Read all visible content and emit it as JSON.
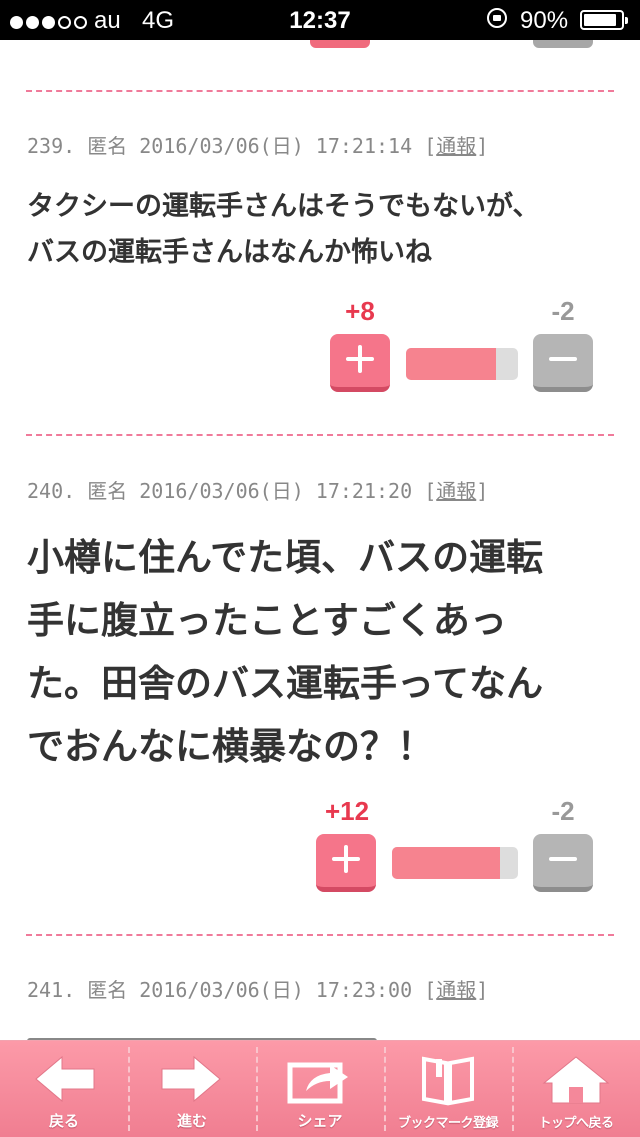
{
  "status_bar": {
    "carrier": "au",
    "network": "4G",
    "time": "12:37",
    "battery_percent": "90%",
    "battery_level": 0.9,
    "signal_bars_filled": 3,
    "signal_bars_total": 5
  },
  "comments": [
    {
      "number": "239.",
      "author": "匿名",
      "datetime": "2016/03/06(日) 17:21:14",
      "report_label": "通報",
      "text_lines": [
        "タクシーの運転手さんはそうでもないが、",
        "バスの運転手さんはなんか怖いね"
      ],
      "plus_count": "+8",
      "minus_count": "-2",
      "plus_ratio": 0.8
    },
    {
      "number": "240.",
      "author": "匿名",
      "datetime": "2016/03/06(日) 17:21:20",
      "report_label": "通報",
      "text_lines": [
        "小樽に住んでた頃、バスの運転",
        "手に腹立ったことすごくあっ",
        "た。田舎のバス運転手ってなん",
        "でおんなに横暴なの？！"
      ],
      "plus_count": "+12",
      "minus_count": "-2",
      "plus_ratio": 0.857
    },
    {
      "number": "241.",
      "author": "匿名",
      "datetime": "2016/03/06(日) 17:23:00",
      "report_label": "通報"
    }
  ],
  "toolbar": {
    "back": "戻る",
    "forward": "進む",
    "share": "シェア",
    "bookmark": "ブックマーク登録",
    "top": "トップへ戻る"
  },
  "colors": {
    "accent_pink": "#f5758a",
    "plus_red": "#e8394f",
    "minus_gray": "#b5b5b5",
    "divider_pink": "#f07a9a"
  }
}
